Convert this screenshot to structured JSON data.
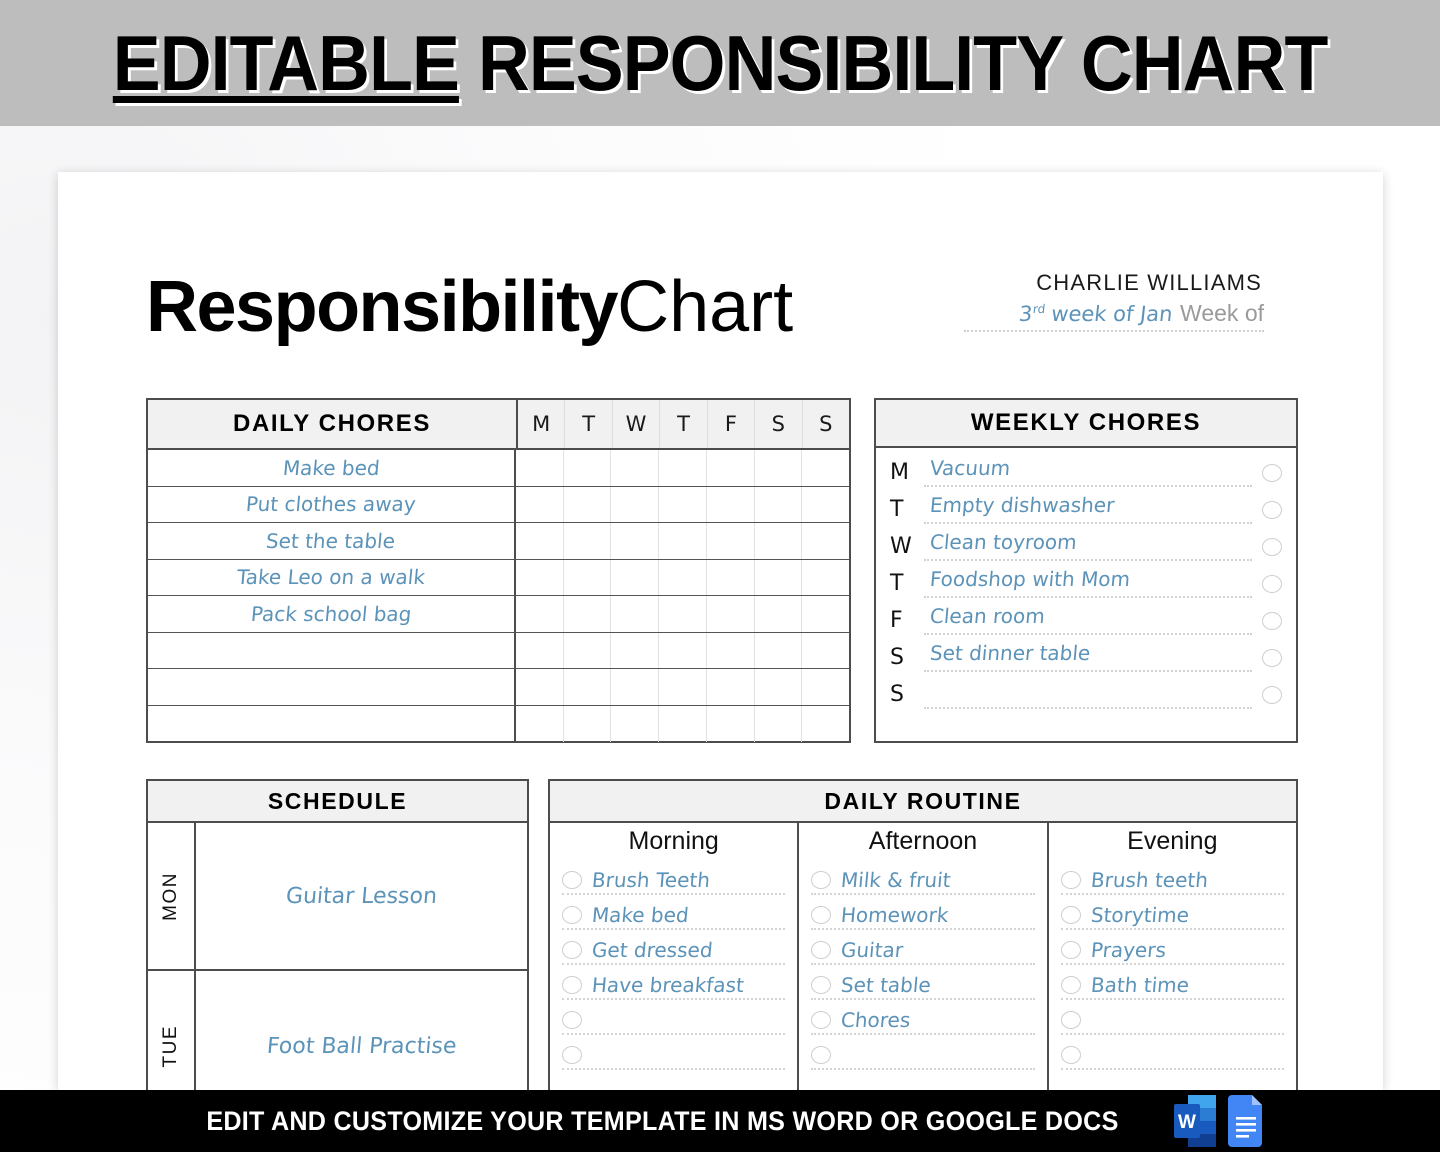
{
  "banner": {
    "title_underlined": "EDITABLE",
    "title_rest": " RESPONSIBILITY CHART"
  },
  "document": {
    "title_bold": "Responsibility",
    "title_light": "Chart",
    "owner_name": "CHARLIE WILLIAMS",
    "week_value_prefix": "3",
    "week_value_sup": "rd",
    "week_value_rest": " week of Jan",
    "week_label": "Week of"
  },
  "daily_chores": {
    "title": "DAILY CHORES",
    "day_columns": [
      "M",
      "T",
      "W",
      "T",
      "F",
      "S",
      "S"
    ],
    "rows": [
      "Make bed",
      "Put clothes away",
      "Set the table",
      "Take Leo on a walk",
      "Pack school bag",
      "",
      "",
      ""
    ]
  },
  "weekly_chores": {
    "title": "WEEKLY CHORES",
    "rows": [
      {
        "day": "M",
        "task": "Vacuum"
      },
      {
        "day": "T",
        "task": "Empty dishwasher"
      },
      {
        "day": "W",
        "task": "Clean toyroom"
      },
      {
        "day": "T",
        "task": "Foodshop with Mom"
      },
      {
        "day": "F",
        "task": "Clean room"
      },
      {
        "day": "S",
        "task": "Set dinner table"
      },
      {
        "day": "S",
        "task": ""
      }
    ]
  },
  "schedule": {
    "title": "SCHEDULE",
    "rows": [
      {
        "day": "MON",
        "activity": "Guitar Lesson"
      },
      {
        "day": "TUE",
        "activity": "Foot Ball Practise"
      }
    ]
  },
  "daily_routine": {
    "title": "DAILY ROUTINE",
    "columns": [
      {
        "name": "Morning",
        "items": [
          "Brush Teeth",
          "Make bed",
          "Get dressed",
          "Have breakfast",
          "",
          ""
        ]
      },
      {
        "name": "Afternoon",
        "items": [
          "Milk & fruit",
          "Homework",
          "Guitar",
          "Set table",
          "Chores",
          ""
        ]
      },
      {
        "name": "Evening",
        "items": [
          "Brush teeth",
          "Storytime",
          "Prayers",
          "Bath time",
          "",
          ""
        ]
      }
    ]
  },
  "footer": {
    "text": "EDIT AND CUSTOMIZE YOUR TEMPLATE IN MS WORD OR GOOGLE DOCS",
    "icons": [
      "ms-word-icon",
      "google-docs-icon"
    ]
  },
  "colors": {
    "banner_bg": "#bdbdbd",
    "handwriting_blue": "#5c93b8",
    "panel_border": "#4d4d4d",
    "panel_head_bg": "#f1f1f1",
    "footer_bg": "#000000",
    "word_blue": "#2b579a",
    "docs_blue": "#4285f4"
  }
}
